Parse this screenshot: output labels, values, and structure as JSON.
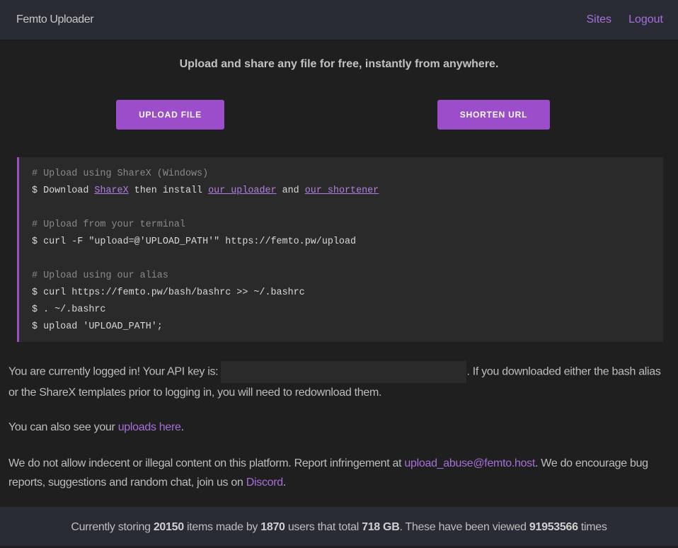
{
  "nav": {
    "brand": "Femto Uploader",
    "links": [
      "Sites",
      "Logout"
    ]
  },
  "tagline": "Upload and share any file for free, instantly from anywhere.",
  "buttons": {
    "upload": "UPLOAD FILE",
    "shorten": "SHORTEN URL"
  },
  "code": {
    "c1": "# Upload using ShareX (Windows)",
    "l1_pre": "$ Download ",
    "l1_link1": "ShareX",
    "l1_mid": " then install ",
    "l1_link2": "our uploader",
    "l1_and": " and ",
    "l1_link3": "our shortener",
    "c2": "# Upload from your terminal",
    "l2": "$ curl -F \"upload=@'UPLOAD_PATH'\" https://femto.pw/upload",
    "c3": "# Upload using our alias",
    "l3": "$ curl https://femto.pw/bash/bashrc >> ~/.bashrc",
    "l4": "$ . ~/.bashrc",
    "l5": "$ upload 'UPLOAD_PATH';"
  },
  "info": {
    "logged_pre": "You are currently logged in! Your API key is: ",
    "logged_post": ". If you downloaded either the bash alias or the ShareX templates prior to logging in, you will need to redownload them.",
    "uploads_pre": "You can also see your ",
    "uploads_link": "uploads here",
    "uploads_post": ".",
    "abuse_pre": "We do not allow indecent or illegal content on this platform. Report infringement at ",
    "abuse_email": "upload_abuse@femto.host",
    "abuse_mid": ". We do encourage bug reports, suggestions and random chat, join us on ",
    "discord": "Discord",
    "abuse_post": "."
  },
  "footer": {
    "t1": "Currently storing ",
    "items": "20150",
    "t2": " items made by ",
    "users": "1870",
    "t3": " users that total ",
    "size": "718 GB",
    "t4": ". These have been viewed ",
    "views": "91953566",
    "t5": " times"
  },
  "colors": {
    "accent": "#9b4dca",
    "link": "#a86fd8",
    "nav_bg": "#292c35",
    "bg": "#1f1f1f"
  }
}
